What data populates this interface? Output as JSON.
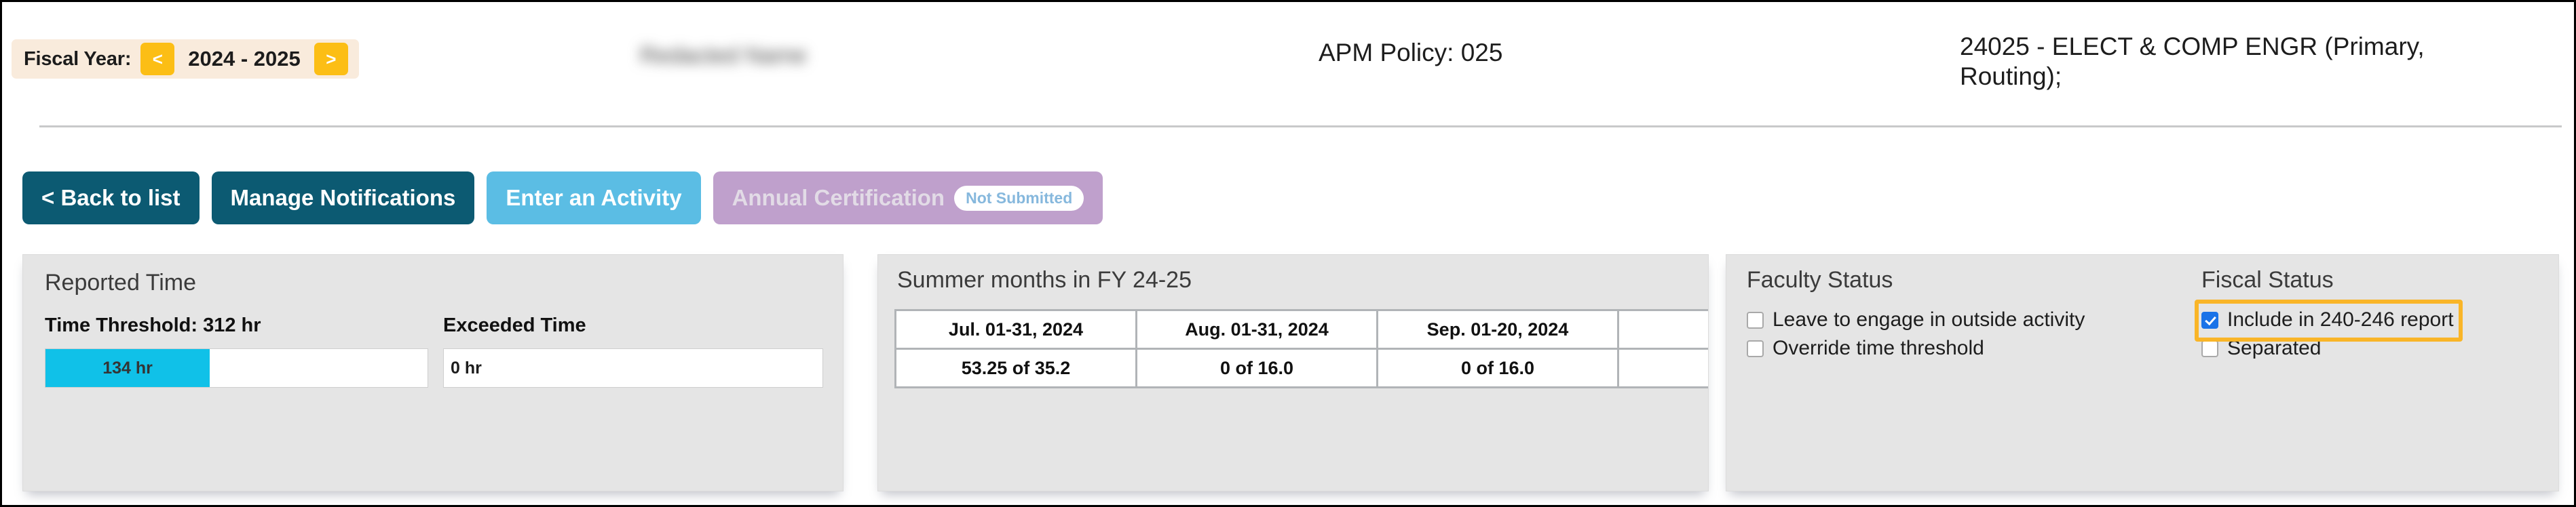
{
  "header": {
    "fiscal_year": {
      "label": "Fiscal Year:",
      "prev_arrow": "<",
      "next_arrow": ">",
      "value": "2024 - 2025"
    },
    "person_name": "Redacted Name",
    "apm_policy": "APM Policy: 025",
    "department": "24025 - ELECT & COMP ENGR (Primary, Routing);"
  },
  "toolbar": {
    "back_to_list": "< Back to list",
    "manage_notifications": "Manage Notifications",
    "enter_activity": "Enter an Activity",
    "annual_certification": "Annual Certification",
    "certification_status": "Not Submitted"
  },
  "reported_time": {
    "title": "Reported Time",
    "threshold_label": "Time Threshold: 312 hr",
    "threshold_hours": 312,
    "reported_hours": 134,
    "progress_text": "134 hr",
    "progress_percent": 43,
    "exceeded_label": "Exceeded Time",
    "exceeded_value": "0 hr"
  },
  "summer_months": {
    "title": "Summer months in FY 24-25",
    "columns": [
      {
        "period": "Jul. 01-31, 2024",
        "usage": "53.25 of 35.2"
      },
      {
        "period": "Aug. 01-31, 2024",
        "usage": "0 of 16.0"
      },
      {
        "period": "Sep. 01-20, 2024",
        "usage": "0 of 16.0"
      },
      {
        "period": "",
        "usage": ""
      }
    ]
  },
  "faculty_status": {
    "title": "Faculty Status",
    "checkboxes": [
      {
        "label": "Leave to engage in outside activity",
        "checked": false
      },
      {
        "label": "Override time threshold",
        "checked": false
      }
    ]
  },
  "fiscal_status": {
    "title": "Fiscal Status",
    "checkboxes": [
      {
        "label": "Include in 240-246 report",
        "checked": true
      },
      {
        "label": "Separated",
        "checked": false
      }
    ]
  },
  "colors": {
    "amber": "#fcbe15",
    "cream": "#f9ebdc",
    "dark_teal": "#0c5a72",
    "light_blue": "#5bbde4",
    "purple": "#bfa0cc",
    "cyan": "#10c1e8",
    "highlight_orange": "#f9b528",
    "panel_gray": "#e5e5e5"
  }
}
